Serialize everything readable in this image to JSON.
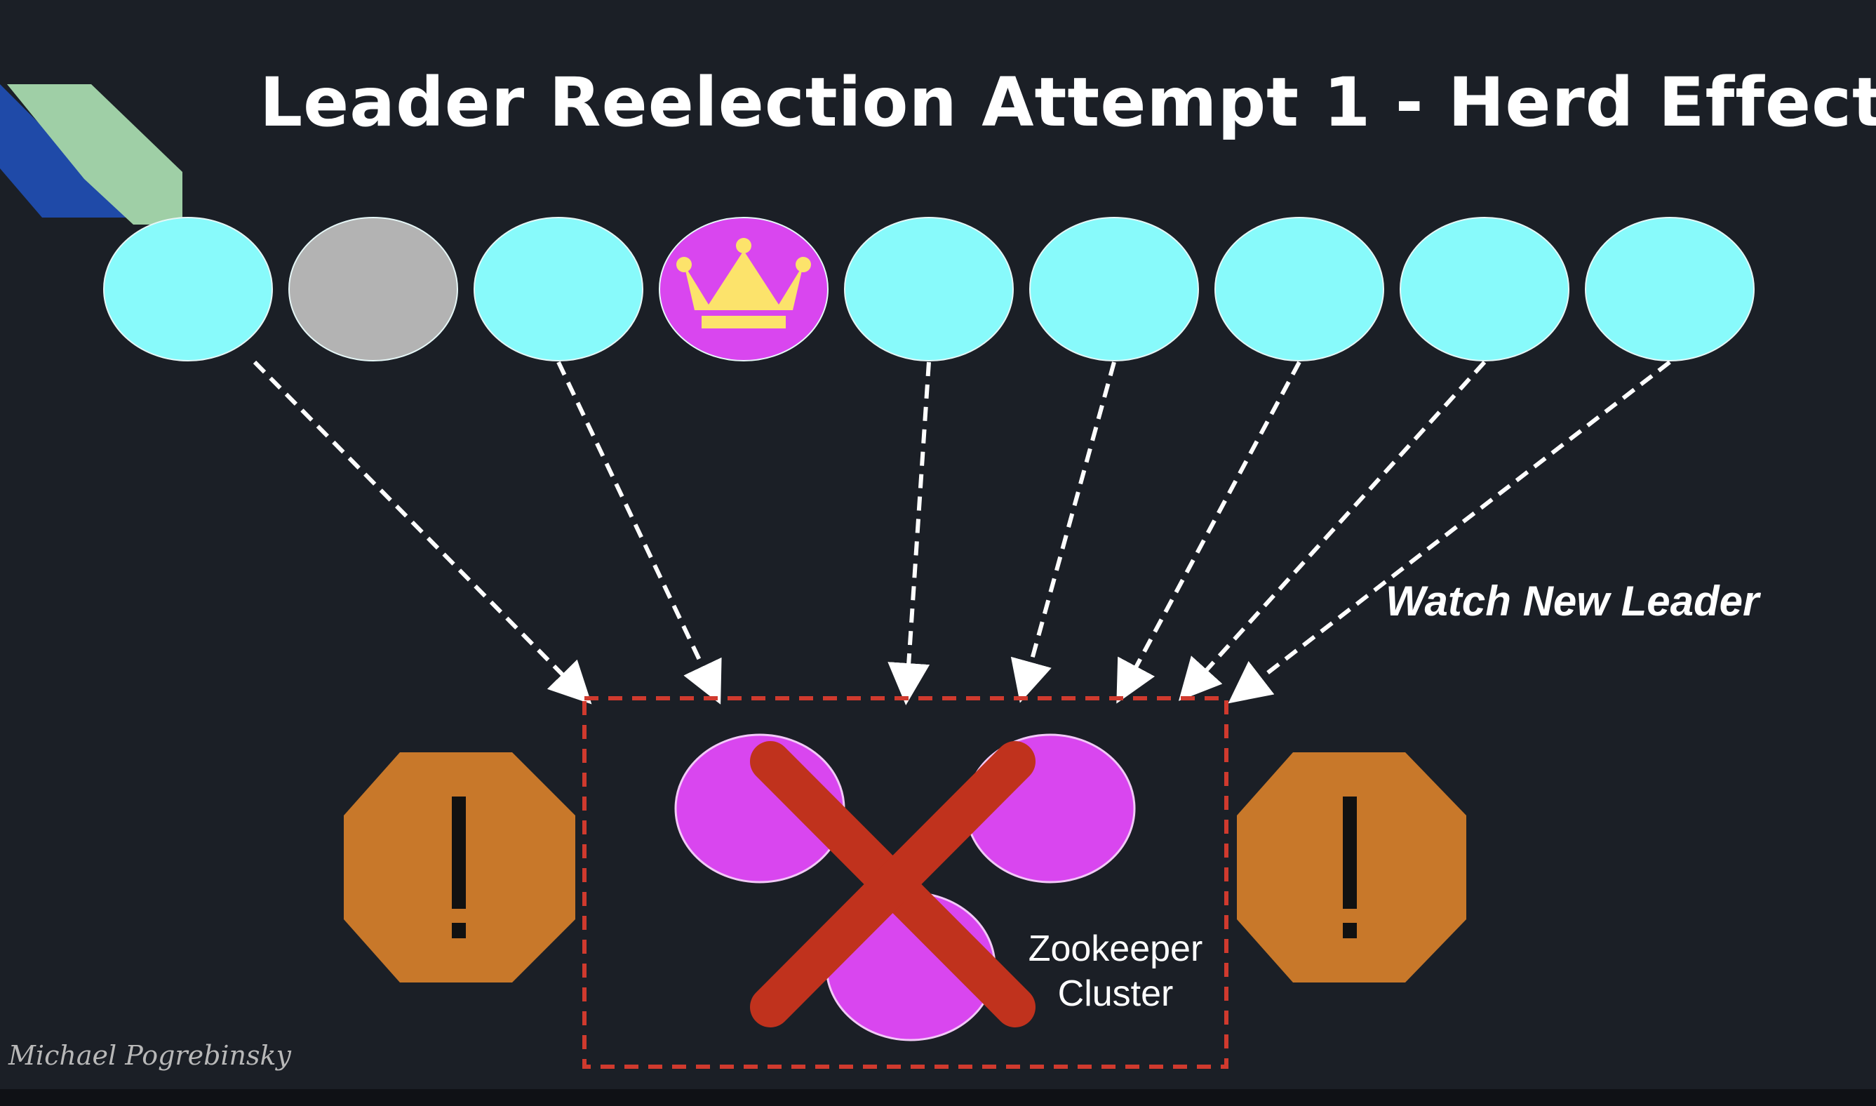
{
  "slide": {
    "title": "Leader Reelection Attempt 1 - Herd Effect",
    "author": "Michael Pogrebinsky"
  },
  "diagram": {
    "nodes": [
      {
        "status": "active",
        "color": "#88fafb"
      },
      {
        "status": "failed",
        "color": "#b3b3b3"
      },
      {
        "status": "active",
        "color": "#88fafb"
      },
      {
        "status": "leader",
        "color": "#d946ef",
        "icon": "crown-icon"
      },
      {
        "status": "active",
        "color": "#88fafb"
      },
      {
        "status": "active",
        "color": "#88fafb"
      },
      {
        "status": "active",
        "color": "#88fafb"
      },
      {
        "status": "active",
        "color": "#88fafb"
      },
      {
        "status": "active",
        "color": "#88fafb"
      }
    ],
    "watch_label": "Watch New Leader",
    "zookeeper": {
      "label_line1": "Zookeeper",
      "label_line2": "Cluster",
      "state": "overloaded",
      "node_color": "#d946ef",
      "cross_icon": "x-mark-icon"
    },
    "warnings": [
      {
        "icon": "warning-octagon-icon",
        "color": "#c8782a"
      },
      {
        "icon": "warning-octagon-icon",
        "color": "#c8782a"
      }
    ],
    "colors": {
      "background": "#1b1f26",
      "arrow": "#ffffff",
      "cluster_border": "#d03a2e",
      "cross": "#c0321d",
      "crown": "#fce36b"
    }
  }
}
